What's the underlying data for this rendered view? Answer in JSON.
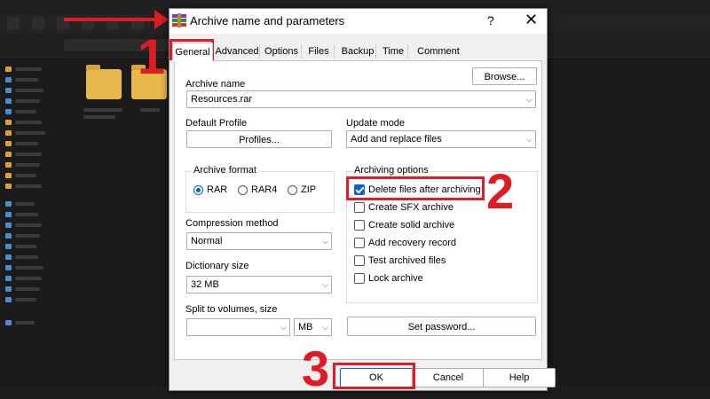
{
  "dialog": {
    "title": "Archive name and parameters",
    "help_glyph": "?",
    "close_glyph": "✕",
    "tabs": [
      "General",
      "Advanced",
      "Options",
      "Files",
      "Backup",
      "Time",
      "Comment"
    ],
    "active_tab": "General"
  },
  "general": {
    "archive_name_label": "Archive name",
    "archive_name_value": "Resources.rar",
    "browse_label": "Browse...",
    "default_profile_label": "Default Profile",
    "profiles_button": "Profiles...",
    "update_mode_label": "Update mode",
    "update_mode_value": "Add and replace files",
    "archive_format_label": "Archive format",
    "formats": [
      {
        "label": "RAR",
        "selected": true
      },
      {
        "label": "RAR4",
        "selected": false
      },
      {
        "label": "ZIP",
        "selected": false
      }
    ],
    "compression_method_label": "Compression method",
    "compression_method_value": "Normal",
    "dictionary_size_label": "Dictionary size",
    "dictionary_size_value": "32 MB",
    "split_label": "Split to volumes, size",
    "split_value": "",
    "split_unit": "MB",
    "archiving_options_label": "Archiving options",
    "options": [
      {
        "label": "Delete files after archiving",
        "checked": true
      },
      {
        "label": "Create SFX archive",
        "checked": false
      },
      {
        "label": "Create solid archive",
        "checked": false
      },
      {
        "label": "Add recovery record",
        "checked": false
      },
      {
        "label": "Test archived files",
        "checked": false
      },
      {
        "label": "Lock archive",
        "checked": false
      }
    ],
    "set_password_button": "Set password..."
  },
  "footer": {
    "ok": "OK",
    "cancel": "Cancel",
    "help": "Help"
  },
  "annotations": {
    "step1": "1",
    "step2": "2",
    "step3": "3"
  },
  "colors": {
    "annotation_red": "#e01b24",
    "accent_blue": "#0a5fd6",
    "folder_yellow": "#e8b84a"
  }
}
